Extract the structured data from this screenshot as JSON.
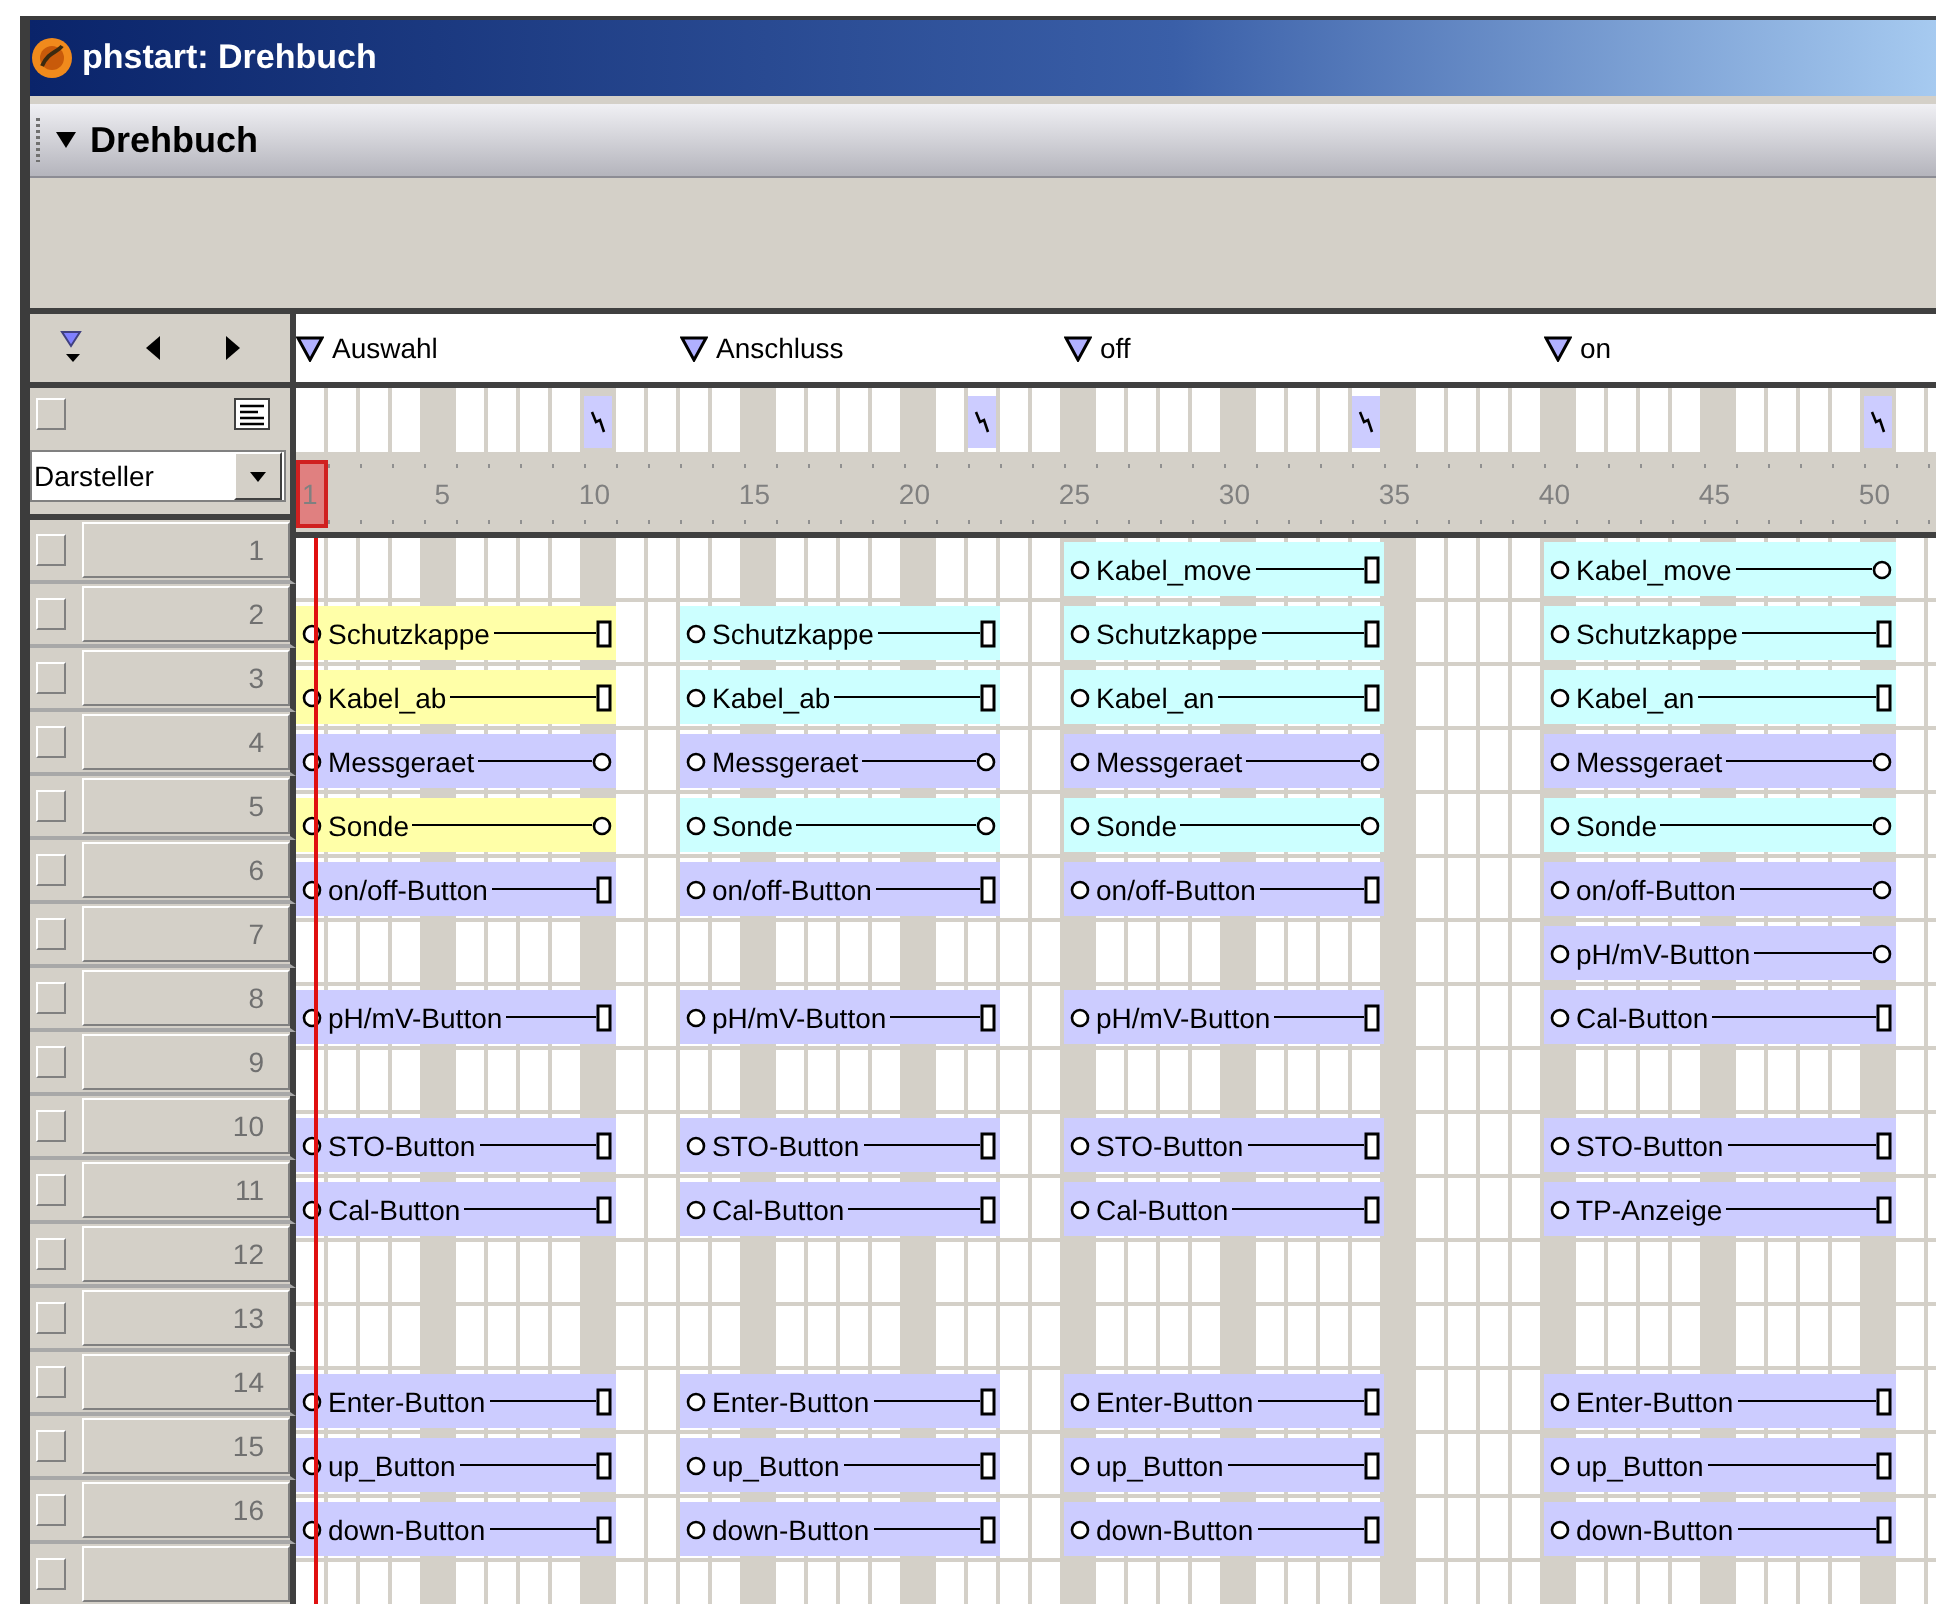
{
  "window": {
    "title": "phstart: Drehbuch"
  },
  "panel": {
    "title": "Drehbuch",
    "expanded": true
  },
  "markers": [
    {
      "label": "Auswahl",
      "has_script": true
    },
    {
      "label": "Anschluss",
      "has_script": true
    },
    {
      "label": "off",
      "has_script": true
    },
    {
      "label": "on",
      "has_script": true
    }
  ],
  "cast_view": {
    "value": "Darsteller"
  },
  "ruler": {
    "labels": [
      "5",
      "10",
      "15",
      "20",
      "25",
      "30",
      "35",
      "40",
      "45",
      "50"
    ]
  },
  "playhead": {
    "frame": "1"
  },
  "channels": [
    {
      "number": "1",
      "sprites": [
        {
          "label": "Kabel_move",
          "color": "#ccffff",
          "kind": "square"
        },
        {
          "label": "Kabel_move",
          "color": "#ccffff",
          "kind": "circle"
        }
      ]
    },
    {
      "number": "2",
      "sprites": [
        {
          "label": "Schutzkappe",
          "color": "#ffffa8",
          "kind": "square"
        },
        {
          "label": "Schutzkappe",
          "color": "#ccffff",
          "kind": "square"
        },
        {
          "label": "Schutzkappe",
          "color": "#ccffff",
          "kind": "square"
        },
        {
          "label": "Schutzkappe",
          "color": "#ccffff",
          "kind": "square"
        }
      ]
    },
    {
      "number": "3",
      "sprites": [
        {
          "label": "Kabel_ab",
          "color": "#ffffa8",
          "kind": "square"
        },
        {
          "label": "Kabel_ab",
          "color": "#ccffff",
          "kind": "square"
        },
        {
          "label": "Kabel_an",
          "color": "#ccffff",
          "kind": "square"
        },
        {
          "label": "Kabel_an",
          "color": "#ccffff",
          "kind": "square"
        }
      ]
    },
    {
      "number": "4",
      "sprites": [
        {
          "label": "Messgeraet",
          "color": "#ccccff",
          "kind": "circle"
        },
        {
          "label": "Messgeraet",
          "color": "#ccccff",
          "kind": "circle"
        },
        {
          "label": "Messgeraet",
          "color": "#ccccff",
          "kind": "circle"
        },
        {
          "label": "Messgeraet",
          "color": "#ccccff",
          "kind": "circle"
        }
      ]
    },
    {
      "number": "5",
      "sprites": [
        {
          "label": "Sonde",
          "color": "#ffffa8",
          "kind": "circle"
        },
        {
          "label": "Sonde",
          "color": "#ccffff",
          "kind": "circle"
        },
        {
          "label": "Sonde",
          "color": "#ccffff",
          "kind": "circle"
        },
        {
          "label": "Sonde",
          "color": "#ccffff",
          "kind": "circle"
        }
      ]
    },
    {
      "number": "6",
      "sprites": [
        {
          "label": "on/off-Button",
          "color": "#ccccff",
          "kind": "square"
        },
        {
          "label": "on/off-Button",
          "color": "#ccccff",
          "kind": "square"
        },
        {
          "label": "on/off-Button",
          "color": "#ccccff",
          "kind": "square"
        },
        {
          "label": "on/off-Button",
          "color": "#ccccff",
          "kind": "circle"
        }
      ]
    },
    {
      "number": "7",
      "sprites": [
        {
          "label": "pH/mV-Button",
          "color": "#ccccff",
          "kind": "circle"
        }
      ]
    },
    {
      "number": "8",
      "sprites": [
        {
          "label": "pH/mV-Button",
          "color": "#ccccff",
          "kind": "square"
        },
        {
          "label": "pH/mV-Button",
          "color": "#ccccff",
          "kind": "square"
        },
        {
          "label": "pH/mV-Button",
          "color": "#ccccff",
          "kind": "square"
        },
        {
          "label": "Cal-Button",
          "color": "#ccccff",
          "kind": "square"
        }
      ]
    },
    {
      "number": "9"
    },
    {
      "number": "10",
      "sprites": [
        {
          "label": "STO-Button",
          "color": "#ccccff",
          "kind": "square"
        },
        {
          "label": "STO-Button",
          "color": "#ccccff",
          "kind": "square"
        },
        {
          "label": "STO-Button",
          "color": "#ccccff",
          "kind": "square"
        },
        {
          "label": "STO-Button",
          "color": "#ccccff",
          "kind": "square"
        }
      ]
    },
    {
      "number": "11",
      "sprites": [
        {
          "label": "Cal-Button",
          "color": "#ccccff",
          "kind": "square"
        },
        {
          "label": "Cal-Button",
          "color": "#ccccff",
          "kind": "square"
        },
        {
          "label": "Cal-Button",
          "color": "#ccccff",
          "kind": "square"
        },
        {
          "label": "TP-Anzeige",
          "color": "#ccccff",
          "kind": "square"
        }
      ]
    },
    {
      "number": "12"
    },
    {
      "number": "13"
    },
    {
      "number": "14",
      "sprites": [
        {
          "label": "Enter-Button",
          "color": "#ccccff",
          "kind": "square"
        },
        {
          "label": "Enter-Button",
          "color": "#ccccff",
          "kind": "square"
        },
        {
          "label": "Enter-Button",
          "color": "#ccccff",
          "kind": "square"
        },
        {
          "label": "Enter-Button",
          "color": "#ccccff",
          "kind": "square"
        }
      ]
    },
    {
      "number": "15",
      "sprites": [
        {
          "label": "up_Button",
          "color": "#ccccff",
          "kind": "square"
        },
        {
          "label": "up_Button",
          "color": "#ccccff",
          "kind": "square"
        },
        {
          "label": "up_Button",
          "color": "#ccccff",
          "kind": "square"
        },
        {
          "label": "up_Button",
          "color": "#ccccff",
          "kind": "square"
        }
      ]
    },
    {
      "number": "16",
      "sprites": [
        {
          "label": "down-Button",
          "color": "#ccccff",
          "kind": "square"
        },
        {
          "label": "down-Button",
          "color": "#ccccff",
          "kind": "square"
        },
        {
          "label": "down-Button",
          "color": "#ccccff",
          "kind": "square"
        },
        {
          "label": "down-Button",
          "color": "#ccccff",
          "kind": "square"
        }
      ]
    }
  ]
}
